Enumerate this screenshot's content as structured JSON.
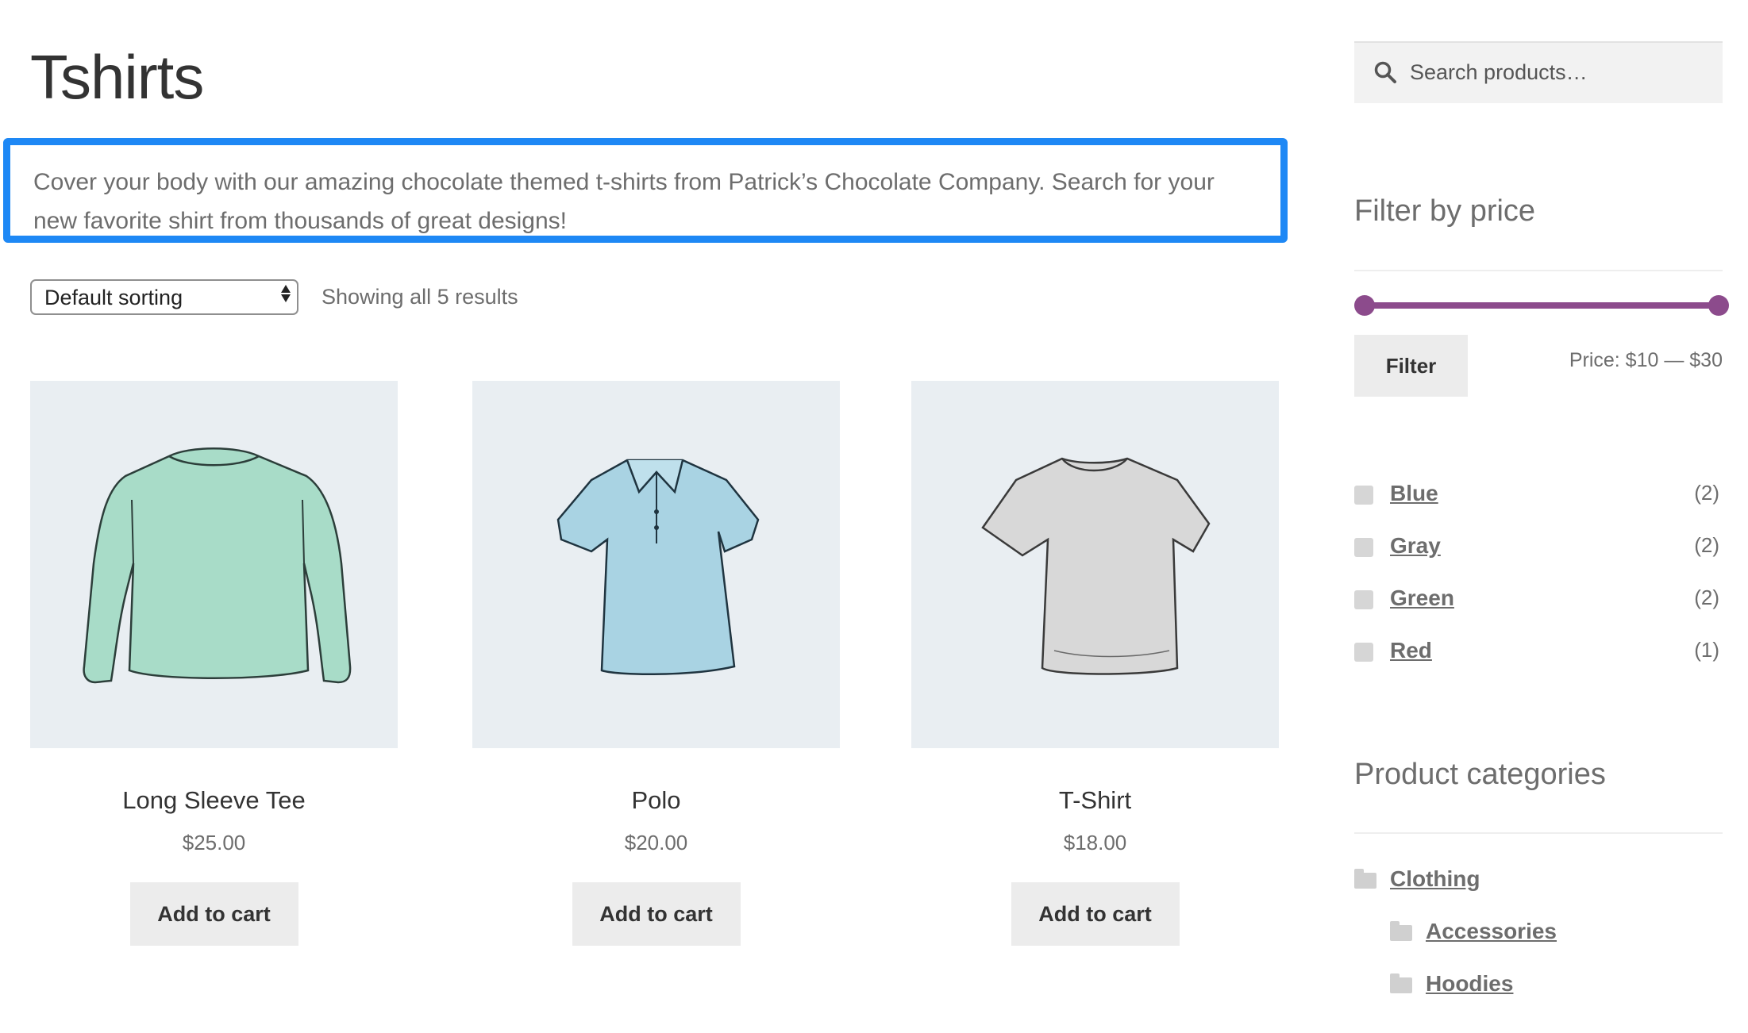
{
  "page": {
    "title": "Tshirts",
    "description": "Cover your body with our amazing chocolate themed t-shirts from Patrick’s Chocolate Company. Search for your new favorite shirt from thousands of great designs!",
    "highlight_color": "#1e88f5"
  },
  "toolbar": {
    "sorting_selected": "Default sorting",
    "result_count": "Showing all 5 results"
  },
  "products": [
    {
      "name": "Long Sleeve Tee",
      "price": "$25.00",
      "button": "Add to cart",
      "image_icon": "long-sleeve-tee-icon",
      "color": "#a8dcc8"
    },
    {
      "name": "Polo",
      "price": "$20.00",
      "button": "Add to cart",
      "image_icon": "polo-shirt-icon",
      "color": "#a9d3e3"
    },
    {
      "name": "T-Shirt",
      "price": "$18.00",
      "button": "Add to cart",
      "image_icon": "tshirt-icon",
      "color": "#d8d8d8"
    }
  ],
  "sidebar": {
    "search": {
      "placeholder": "Search products…",
      "icon": "search-icon"
    },
    "price_filter": {
      "title": "Filter by price",
      "button": "Filter",
      "label": "Price: $10 — $30",
      "slider_color": "#8c4b8c"
    },
    "attributes": [
      {
        "label": "Blue",
        "count": "(2)"
      },
      {
        "label": "Gray",
        "count": "(2)"
      },
      {
        "label": "Green",
        "count": "(2)"
      },
      {
        "label": "Red",
        "count": "(1)"
      }
    ],
    "categories": {
      "title": "Product categories",
      "items": [
        {
          "label": "Clothing",
          "level": 0
        },
        {
          "label": "Accessories",
          "level": 1
        },
        {
          "label": "Hoodies",
          "level": 1
        }
      ]
    }
  }
}
